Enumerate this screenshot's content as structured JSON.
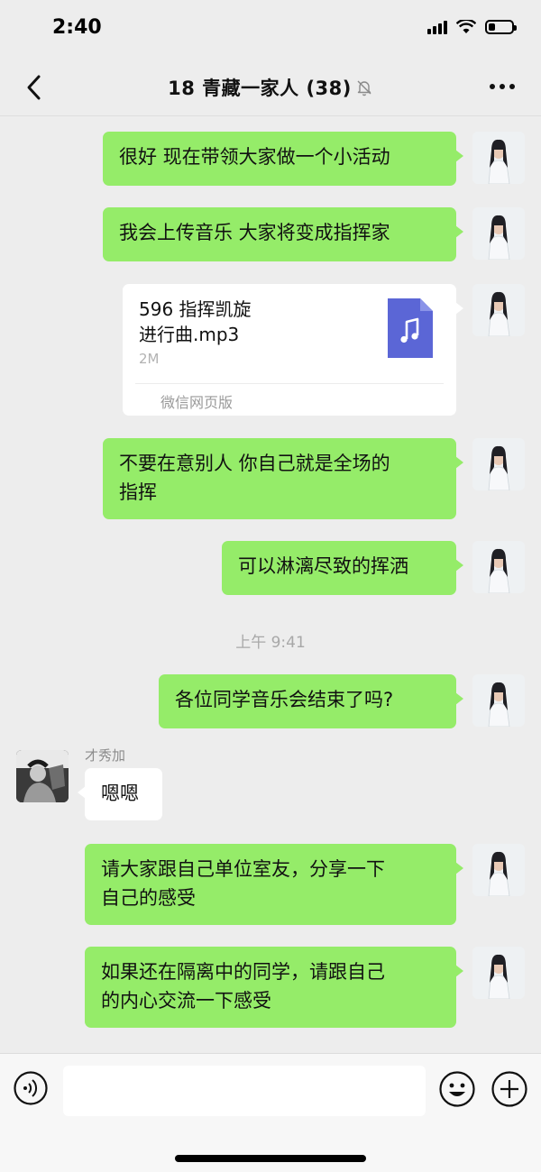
{
  "status_bar": {
    "time": "2:40",
    "battery_level": 0.3
  },
  "nav": {
    "back_icon": "chevron-left-icon",
    "title": "18 青藏一家人 (38)",
    "mute_icon": "bell-off-icon",
    "more_icon": "ellipsis-icon"
  },
  "messages": [
    {
      "text": "很好 现在带领大家做一个小活动"
    },
    {
      "text": "我会上传音乐 大家将变成指挥家"
    },
    {
      "file": {
        "name": "596 指挥凯旋进行曲.mp3",
        "name_line1": "596 指挥凯旋",
        "name_line2": "进行曲.mp3",
        "size": "2M",
        "source": "微信网页版",
        "icon": "music-note-icon"
      }
    },
    {
      "line1": "不要在意别人 你自己就是全场的",
      "line2": "指挥"
    },
    {
      "text": "可以淋漓尽致的挥洒"
    },
    {
      "timestamp": "上午 9:41"
    },
    {
      "text": "各位同学音乐会结束了吗?"
    },
    {
      "sender": "才秀加",
      "text": "嗯嗯"
    },
    {
      "line1": "请大家跟自己单位室友，分享一下",
      "line2": "自己的感受"
    },
    {
      "line1": "如果还在隔离中的同学，请跟自己",
      "line2": "的内心交流一下感受"
    }
  ],
  "input_bar": {
    "voice_icon": "voice-icon",
    "input_value": "",
    "emoji_icon": "emoji-icon",
    "plus_icon": "plus-icon"
  },
  "colors": {
    "background": "#ededed",
    "sent_bubble": "#95ec69",
    "received_bubble": "#ffffff",
    "file_icon": "#5b66d6"
  }
}
